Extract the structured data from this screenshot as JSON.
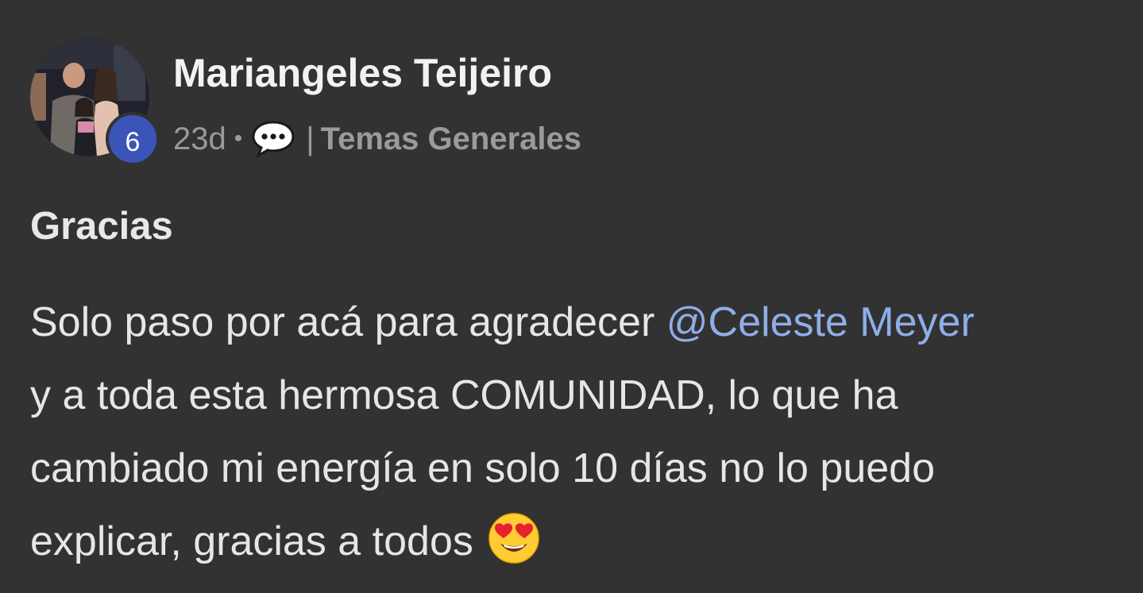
{
  "author": {
    "name": "Mariangeles Teijeiro",
    "level": "6"
  },
  "meta": {
    "time": "23d",
    "separator_dot": "•",
    "icon": "comment-bubble-icon",
    "pipe": "|",
    "category": "Temas Generales"
  },
  "post": {
    "title": "Gracias",
    "body": {
      "line1_text": "Solo paso por acá para agradecer ",
      "mention": "@Celeste Meyer",
      "line2_text": "y a toda esta hermosa COMUNIDAD, lo que ha",
      "line3_text": "cambiado mi energía en solo 10 días no lo puedo",
      "line4_text": "explicar, gracias a todos ",
      "emoji": "heart-eyes-emoji"
    }
  },
  "colors": {
    "background": "#323232",
    "badge": "#3a54b8",
    "mention": "#8eaee8",
    "meta_text": "#9a9a9a"
  }
}
